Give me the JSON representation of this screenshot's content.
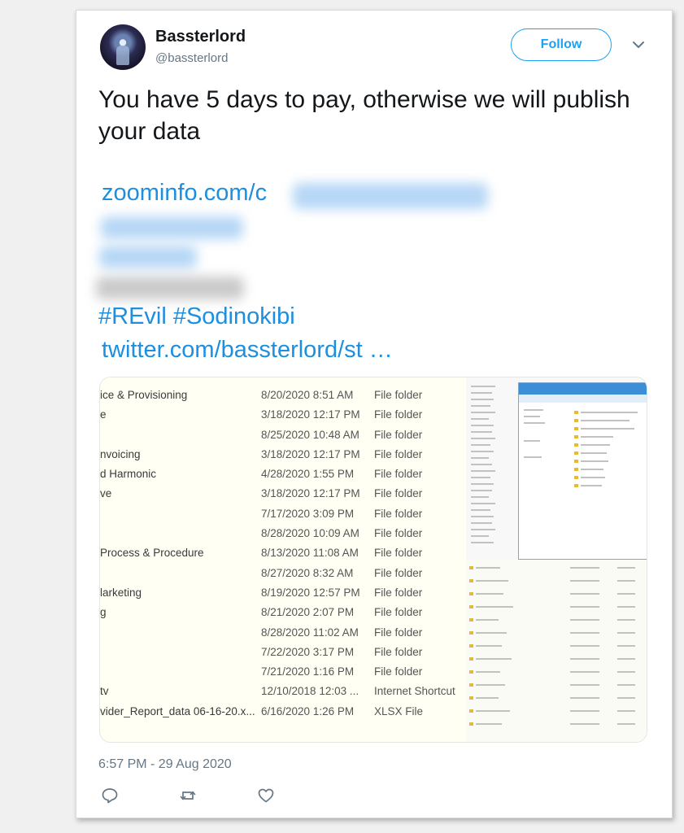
{
  "tweet": {
    "user_name": "Bassterlord",
    "user_handle": "@bassterlord",
    "follow_label": "Follow",
    "text": "You have 5 days to pay, otherwise we will publish your data",
    "link_visible": "zoominfo.com/c",
    "hashtags": [
      "#REvil",
      "#Sodinokibi"
    ],
    "twitter_link": "twitter.com/bassterlord/st …",
    "timestamp": "6:57 PM - 29 Aug 2020"
  },
  "media": {
    "rows": [
      {
        "name": "ice & Provisioning",
        "date": "8/20/2020 8:51 AM",
        "type": "File folder"
      },
      {
        "name": "e",
        "date": "3/18/2020 12:17 PM",
        "type": "File folder"
      },
      {
        "name": "",
        "date": "8/25/2020 10:48 AM",
        "type": "File folder"
      },
      {
        "name": "nvoicing",
        "date": "3/18/2020 12:17 PM",
        "type": "File folder"
      },
      {
        "name": "d Harmonic",
        "date": "4/28/2020 1:55 PM",
        "type": "File folder"
      },
      {
        "name": "ve",
        "date": "3/18/2020 12:17 PM",
        "type": "File folder"
      },
      {
        "name": "",
        "date": "7/17/2020 3:09 PM",
        "type": "File folder"
      },
      {
        "name": "",
        "date": "8/28/2020 10:09 AM",
        "type": "File folder"
      },
      {
        "name": "Process & Procedure",
        "date": "8/13/2020 11:08 AM",
        "type": "File folder"
      },
      {
        "name": "",
        "date": "8/27/2020 8:32 AM",
        "type": "File folder"
      },
      {
        "name": "larketing",
        "date": "8/19/2020 12:57 PM",
        "type": "File folder"
      },
      {
        "name": "g",
        "date": "8/21/2020 2:07 PM",
        "type": "File folder"
      },
      {
        "name": "",
        "date": "8/28/2020 11:02 AM",
        "type": "File folder"
      },
      {
        "name": "",
        "date": "7/22/2020 3:17 PM",
        "type": "File folder"
      },
      {
        "name": "",
        "date": "7/21/2020 1:16 PM",
        "type": "File folder"
      },
      {
        "name": "tv",
        "date": "12/10/2018 12:03 ...",
        "type": "Internet Shortcut"
      },
      {
        "name": "vider_Report_data 06-16-20.x...",
        "date": "6/16/2020 1:26 PM",
        "type": "XLSX File"
      }
    ]
  },
  "icons": [
    "reply-icon",
    "retweet-icon",
    "like-icon",
    "chevron-down-icon"
  ],
  "colors": {
    "link": "#1d8fe0",
    "follow": "#1da1f2",
    "muted": "#657786"
  }
}
